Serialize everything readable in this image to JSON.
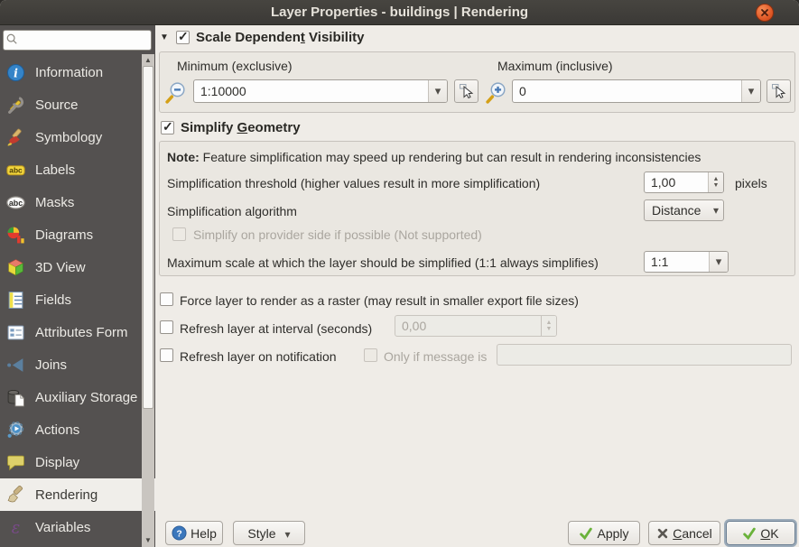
{
  "window": {
    "title": "Layer Properties - buildings | Rendering"
  },
  "colors": {
    "titlebar_bg": "#3f3d3a",
    "sidebar_bg": "#545150",
    "panel_bg": "#efece7",
    "selected_item_bg": "#f0eeea",
    "close_button": "#e0602e",
    "check_green": "#6ab23a"
  },
  "sidebar": {
    "search_value": "",
    "items": [
      {
        "label": "Information",
        "icon": "information-icon"
      },
      {
        "label": "Source",
        "icon": "source-icon"
      },
      {
        "label": "Symbology",
        "icon": "symbology-icon"
      },
      {
        "label": "Labels",
        "icon": "labels-icon"
      },
      {
        "label": "Masks",
        "icon": "masks-icon"
      },
      {
        "label": "Diagrams",
        "icon": "diagrams-icon"
      },
      {
        "label": "3D View",
        "icon": "3d-view-icon"
      },
      {
        "label": "Fields",
        "icon": "fields-icon"
      },
      {
        "label": "Attributes Form",
        "icon": "attributes-form-icon"
      },
      {
        "label": "Joins",
        "icon": "joins-icon"
      },
      {
        "label": "Auxiliary Storage",
        "icon": "auxiliary-storage-icon"
      },
      {
        "label": "Actions",
        "icon": "actions-icon"
      },
      {
        "label": "Display",
        "icon": "display-icon"
      },
      {
        "label": "Rendering",
        "icon": "rendering-icon",
        "selected": true
      },
      {
        "label": "Variables",
        "icon": "variables-icon"
      }
    ]
  },
  "sections": {
    "scale": {
      "title_pre": "Scale Dependen",
      "title_accel": "t",
      "title_post": " Visibility",
      "checked": true,
      "minimum_label": "Minimum (exclusive)",
      "minimum_value": "1:10000",
      "maximum_label": "Maximum (inclusive)",
      "maximum_value": "0"
    },
    "simplify": {
      "title_pre": "Simplify ",
      "title_accel": "G",
      "title_post": "eometry",
      "checked": true,
      "note_bold": "Note:",
      "note_text": " Feature simplification may speed up rendering but can result in rendering inconsistencies",
      "threshold_label": "Simplification threshold (higher values result in more simplification)",
      "threshold_value": "1,00",
      "threshold_unit": "pixels",
      "algorithm_label": "Simplification algorithm",
      "algorithm_value": "Distance",
      "provider_label": "Simplify on provider side if possible (Not supported)",
      "max_scale_label": "Maximum scale at which the layer should be simplified (1:1 always simplifies)",
      "max_scale_value": "1:1"
    },
    "options": {
      "force_raster_label": "Force layer to render as a raster (may result in smaller export file sizes)",
      "refresh_interval_label": "Refresh layer at interval (seconds)",
      "refresh_interval_value": "0,00",
      "refresh_notification_label": "Refresh layer on notification",
      "only_if_message_label": "Only if message is",
      "notification_message_value": ""
    }
  },
  "footer": {
    "help_label": "Help",
    "style_label": "Style",
    "apply_label": "Apply",
    "cancel_pre": "",
    "cancel_accel": "C",
    "cancel_post": "ancel",
    "ok_pre": "",
    "ok_accel": "O",
    "ok_post": "K"
  }
}
